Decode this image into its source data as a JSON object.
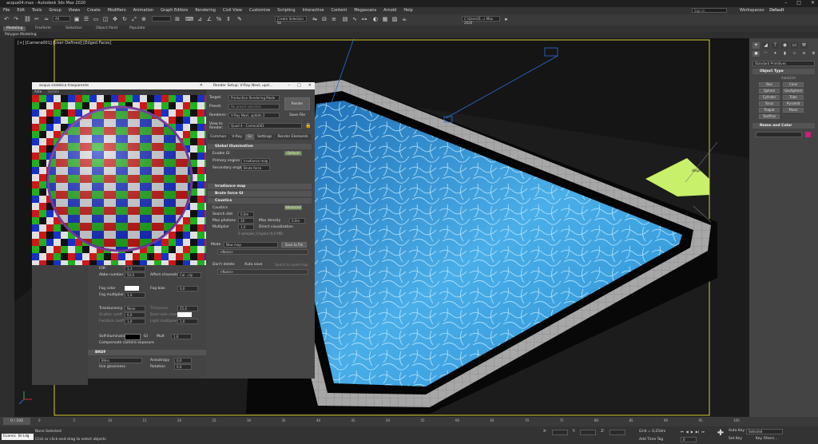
{
  "app": {
    "title": "acqua04.max - Autodesk 3ds Max 2020",
    "window_controls": [
      "–",
      "□",
      "✕"
    ]
  },
  "menu": {
    "items": [
      "File",
      "Edit",
      "Tools",
      "Group",
      "Views",
      "Create",
      "Modifiers",
      "Animation",
      "Graph Editors",
      "Rendering",
      "Civil View",
      "Customize",
      "Scripting",
      "Interactive",
      "Content",
      "Megascans",
      "Arnold",
      "Help"
    ],
    "search_placeholder": "Sign In",
    "workspaces_label": "Workspaces:",
    "workspaces_value": "Default"
  },
  "toolbar": {
    "view_dropdown": "All",
    "selection_set": "Create Selection Se",
    "path_dropdown": "C:\\Users\\S...s Max 2020"
  },
  "ribbon": {
    "tabs": [
      "Modeling",
      "Freeform",
      "Selection",
      "Object Paint",
      "Populate"
    ],
    "sub_label": "Polygon Modeling"
  },
  "viewport": {
    "label": "[+] [Camera001] [User Defined] [Edged Faces]",
    "object_label": "dispPlane"
  },
  "material_editor": {
    "title": "acqua sintetica trasparente",
    "auto_label": "Auto",
    "update_label": "Update",
    "rows": {
      "ior_label": "IOR",
      "ior_value": "1,3",
      "abbe_label": "Abbe number",
      "abbe_value": "50,0",
      "affect_channels_label": "Affect channels",
      "affect_channels_value": "Col...nly",
      "fog_color_label": "Fog color",
      "fog_bias_label": "Fog bias",
      "fog_bias_value": "0,0",
      "fog_mult_label": "Fog multiplier",
      "fog_mult_value": "1,0",
      "translucency_label": "Translucency",
      "translucency_value": "None",
      "thickness_label": "Thickness",
      "thickness_value": "25,4",
      "scatter_label": "Scatter coeff",
      "scatter_value": "0,0",
      "back_side_label": "Back-side color",
      "fwd_label": "Fwd/bck coeff",
      "fwd_value": "1,0",
      "light_mult_label": "Light multiplier",
      "light_mult_value": "1,0",
      "selfillum_label": "Self-illumination",
      "gi_label": "GI",
      "mult_label": "Mult",
      "mult_value": "1,0",
      "compensate_label": "Compensate camera exposure",
      "brdf_header": "BRDF",
      "brdf_type": "Blinn",
      "use_glossiness": "Use glossiness",
      "anisotropy_label": "Anisotropy",
      "anisotropy_value": "0,0",
      "rotation_label": "Rotation",
      "rotation_value": "0,0"
    }
  },
  "render_setup": {
    "title": "Render Setup: V-Ray Next, upd...",
    "target_label": "Target:",
    "target_value": "Production Rendering Mode",
    "preset_label": "Preset:",
    "preset_value": "No preset selected",
    "renderer_label": "Renderer:",
    "renderer_value": "V-Ray Next, update 2",
    "view_label": "View to Render:",
    "view_value": "Quad 4 - Camera001",
    "render_button": "Render",
    "save_file": "Save File",
    "tabs": [
      "Common",
      "V-Ray",
      "GI",
      "Settings",
      "Render Elements"
    ],
    "gi_header": "Global illumination",
    "enable_gi": "Enable GI",
    "default_button": "Default",
    "primary_label": "Primary engine",
    "primary_value": "Irradiance map",
    "secondary_label": "Secondary engine",
    "secondary_value": "Brute force",
    "irradiance_header": "Irradiance map",
    "brute_header": "Brute force GI",
    "caustics_header": "Caustics",
    "caustics_check": "Caustics",
    "advanced_button": "Advanced",
    "search_dist_label": "Search dist",
    "search_dist_value": "0,0m",
    "max_photons_label": "Max photons",
    "max_photons_value": "10",
    "max_density_label": "Max density",
    "max_density_value": "0,0m",
    "multiplier_label": "Multiplier",
    "multiplier_value": "1,0",
    "direct_vis": "Direct visualization",
    "samples_info": "0 samples; 0 bytes (0,0 MB)",
    "mode_label": "Mode",
    "mode_value": "New map",
    "save_to_file": "Save to file",
    "none_1": "<None>",
    "dont_delete": "Don't delete",
    "auto_save": "Auto save",
    "switch_saved": "Switch to saved map",
    "none_2": "<None>"
  },
  "command_panel": {
    "category": "Standard Primitives",
    "object_type_header": "Object Type",
    "autogrid": "AutoGrid",
    "buttons": [
      "Box",
      "Cone",
      "Sphere",
      "GeoSphere",
      "Cylinder",
      "Tube",
      "Torus",
      "Pyramid",
      "Teapot",
      "Plane",
      "TextPlus"
    ],
    "name_color_header": "Name and Color",
    "accent_color": "#c8207a"
  },
  "timeline": {
    "frame_display": "0 / 100",
    "ticks": [
      "0",
      "5",
      "10",
      "15",
      "20",
      "25",
      "30",
      "35",
      "40",
      "45",
      "50",
      "55",
      "60",
      "65",
      "70",
      "75",
      "80",
      "85",
      "90",
      "95",
      "100"
    ]
  },
  "status": {
    "script_label": "Gianni Bridg",
    "status_text": "None Selected",
    "prompt_text": "Click or click-and-drag to select objects",
    "x_label": "X:",
    "y_label": "Y:",
    "z_label": "Z:",
    "grid_label": "Grid = 0,254m",
    "add_time_tag": "Add Time Tag",
    "auto_key": "Auto Key",
    "set_key": "Set Key",
    "selected_value": "Selected",
    "key_filters": "Key Filters...",
    "frame_value": "0"
  },
  "colors": {
    "water": "#2f8fd0",
    "coping": "#a7a7a7",
    "wall": "#101010",
    "ground": "#2a2a2a",
    "display_plane": "#c8f06a",
    "safe_frame": "#d6c832"
  }
}
